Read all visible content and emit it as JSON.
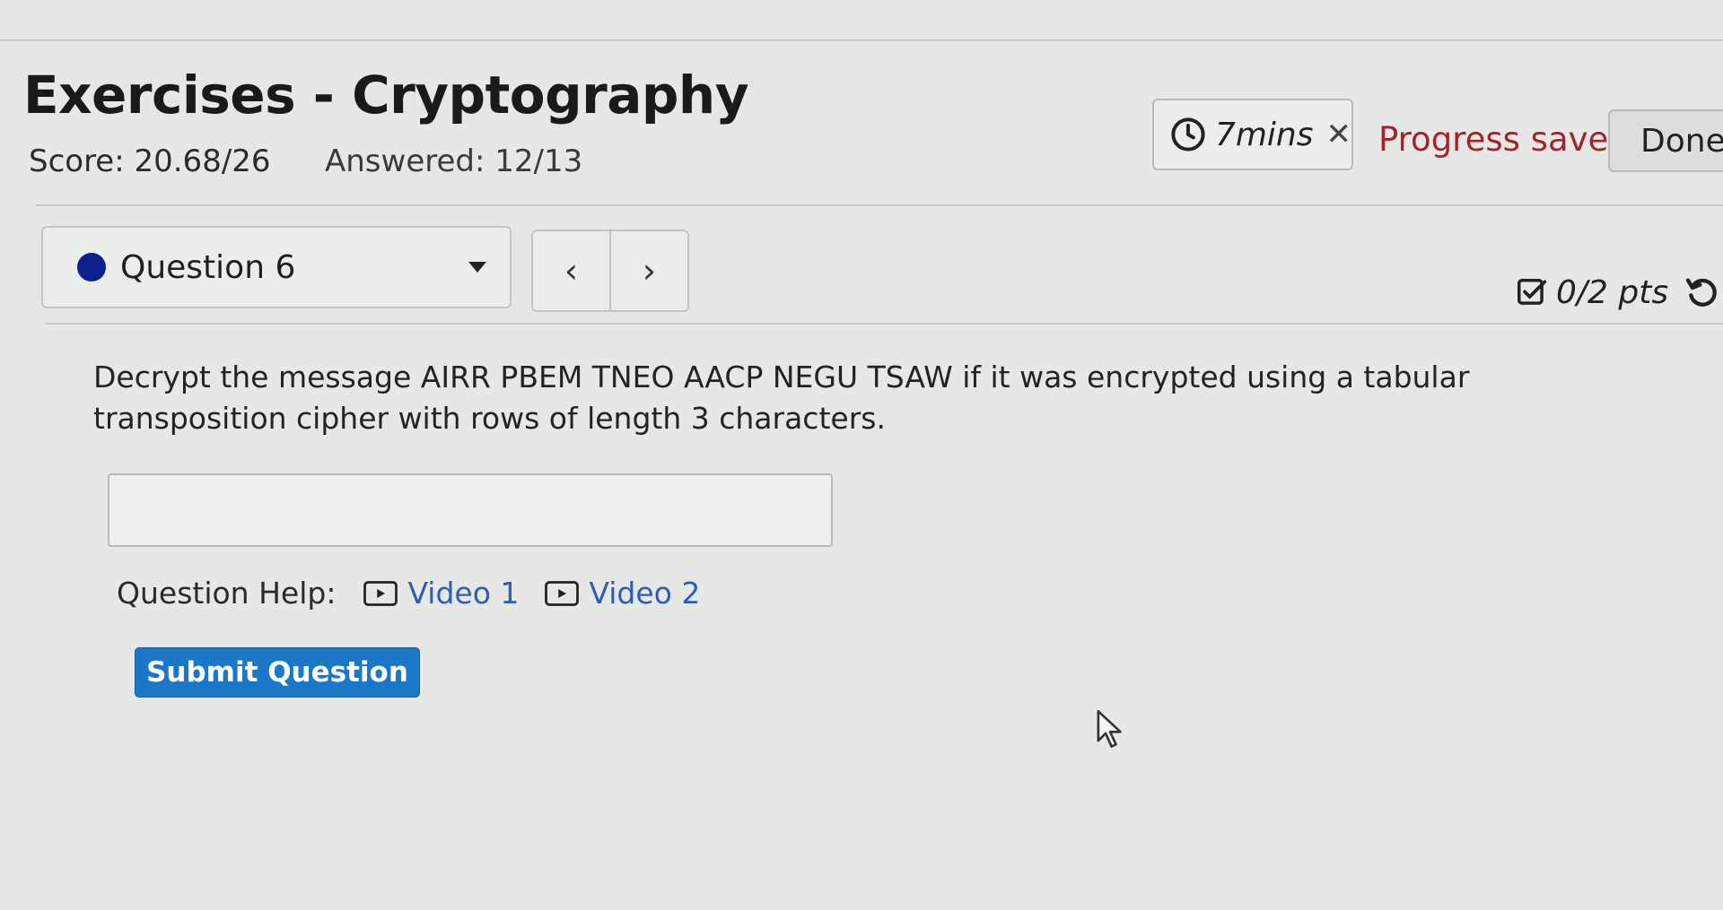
{
  "header": {
    "title": "Exercises - Cryptography",
    "score": "Score: 20.68/26",
    "answered": "Answered: 12/13",
    "timer": "7mins",
    "timer_close": "✕",
    "progress_status": "Progress saved",
    "done_label": "Done",
    "accent_color": "#a3232f"
  },
  "question_nav": {
    "selected_question": "Question 6",
    "prev_symbol": "‹",
    "next_symbol": "›",
    "points": "0/2 pts"
  },
  "question": {
    "text": "Decrypt the message AIRR PBEM TNEO AACP NEGU TSAW if it was encrypted using a tabular transposition cipher with rows of length 3 characters.",
    "answer_value": "",
    "help_label": "Question Help:",
    "help_links": [
      "Video 1",
      "Video 2"
    ],
    "submit_label": "Submit Question",
    "submit_color": "#1b77c8"
  },
  "icons": [
    "clock-icon",
    "close-icon",
    "caret-down-icon",
    "chevron-left-icon",
    "chevron-right-icon",
    "checkbox-icon",
    "retry-icon",
    "play-video-icon",
    "mouse-cursor-icon"
  ]
}
